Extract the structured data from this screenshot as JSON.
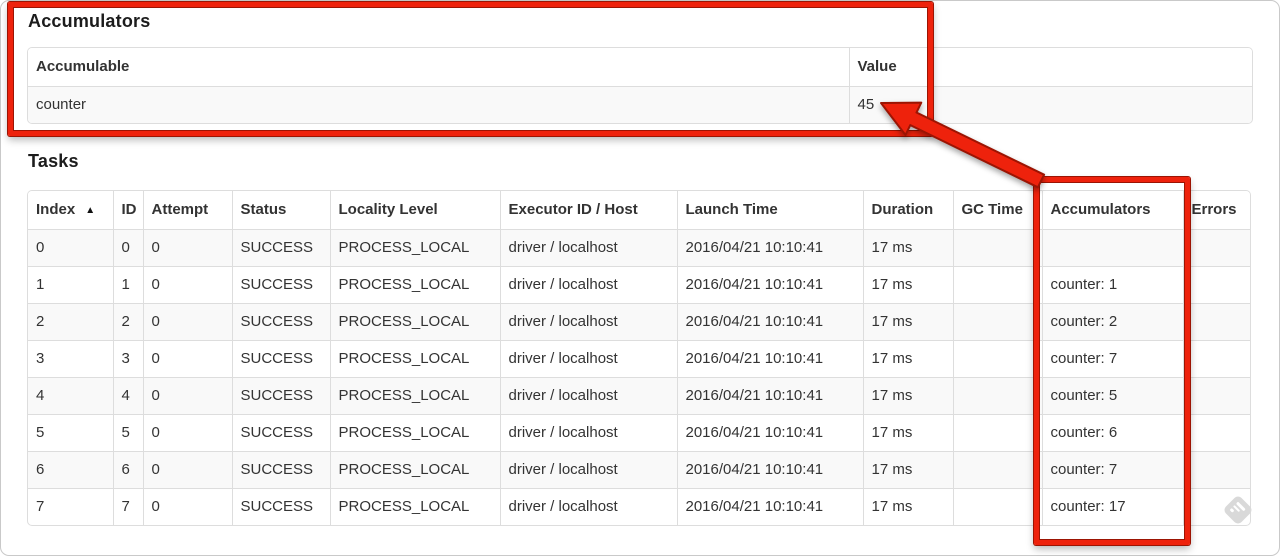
{
  "accumulators_section": {
    "title": "Accumulators",
    "table": {
      "headers": [
        "Accumulable",
        "Value"
      ],
      "rows": [
        [
          "counter",
          "45"
        ]
      ]
    }
  },
  "tasks_section": {
    "title": "Tasks",
    "table": {
      "headers": [
        "Index",
        "ID",
        "Attempt",
        "Status",
        "Locality Level",
        "Executor ID / Host",
        "Launch Time",
        "Duration",
        "GC Time",
        "Accumulators",
        "Errors"
      ],
      "sort_column": "Index",
      "sort_icon": "▲",
      "field_names": [
        "index",
        "id",
        "attempt",
        "status",
        "locality-level",
        "executor-id-host",
        "launch-time",
        "duration",
        "gc-time",
        "accumulators",
        "errors"
      ],
      "rows": [
        [
          "0",
          "0",
          "0",
          "SUCCESS",
          "PROCESS_LOCAL",
          "driver / localhost",
          "2016/04/21 10:10:41",
          "17 ms",
          "",
          "",
          ""
        ],
        [
          "1",
          "1",
          "0",
          "SUCCESS",
          "PROCESS_LOCAL",
          "driver / localhost",
          "2016/04/21 10:10:41",
          "17 ms",
          "",
          "counter: 1",
          ""
        ],
        [
          "2",
          "2",
          "0",
          "SUCCESS",
          "PROCESS_LOCAL",
          "driver / localhost",
          "2016/04/21 10:10:41",
          "17 ms",
          "",
          "counter: 2",
          ""
        ],
        [
          "3",
          "3",
          "0",
          "SUCCESS",
          "PROCESS_LOCAL",
          "driver / localhost",
          "2016/04/21 10:10:41",
          "17 ms",
          "",
          "counter: 7",
          ""
        ],
        [
          "4",
          "4",
          "0",
          "SUCCESS",
          "PROCESS_LOCAL",
          "driver / localhost",
          "2016/04/21 10:10:41",
          "17 ms",
          "",
          "counter: 5",
          ""
        ],
        [
          "5",
          "5",
          "0",
          "SUCCESS",
          "PROCESS_LOCAL",
          "driver / localhost",
          "2016/04/21 10:10:41",
          "17 ms",
          "",
          "counter: 6",
          ""
        ],
        [
          "6",
          "6",
          "0",
          "SUCCESS",
          "PROCESS_LOCAL",
          "driver / localhost",
          "2016/04/21 10:10:41",
          "17 ms",
          "",
          "counter: 7",
          ""
        ],
        [
          "7",
          "7",
          "0",
          "SUCCESS",
          "PROCESS_LOCAL",
          "driver / localhost",
          "2016/04/21 10:10:41",
          "17 ms",
          "",
          "counter: 17",
          ""
        ]
      ]
    }
  },
  "annotations": {
    "highlight_color": "#ee220c",
    "highlight_outline_color": "#9c1403"
  }
}
